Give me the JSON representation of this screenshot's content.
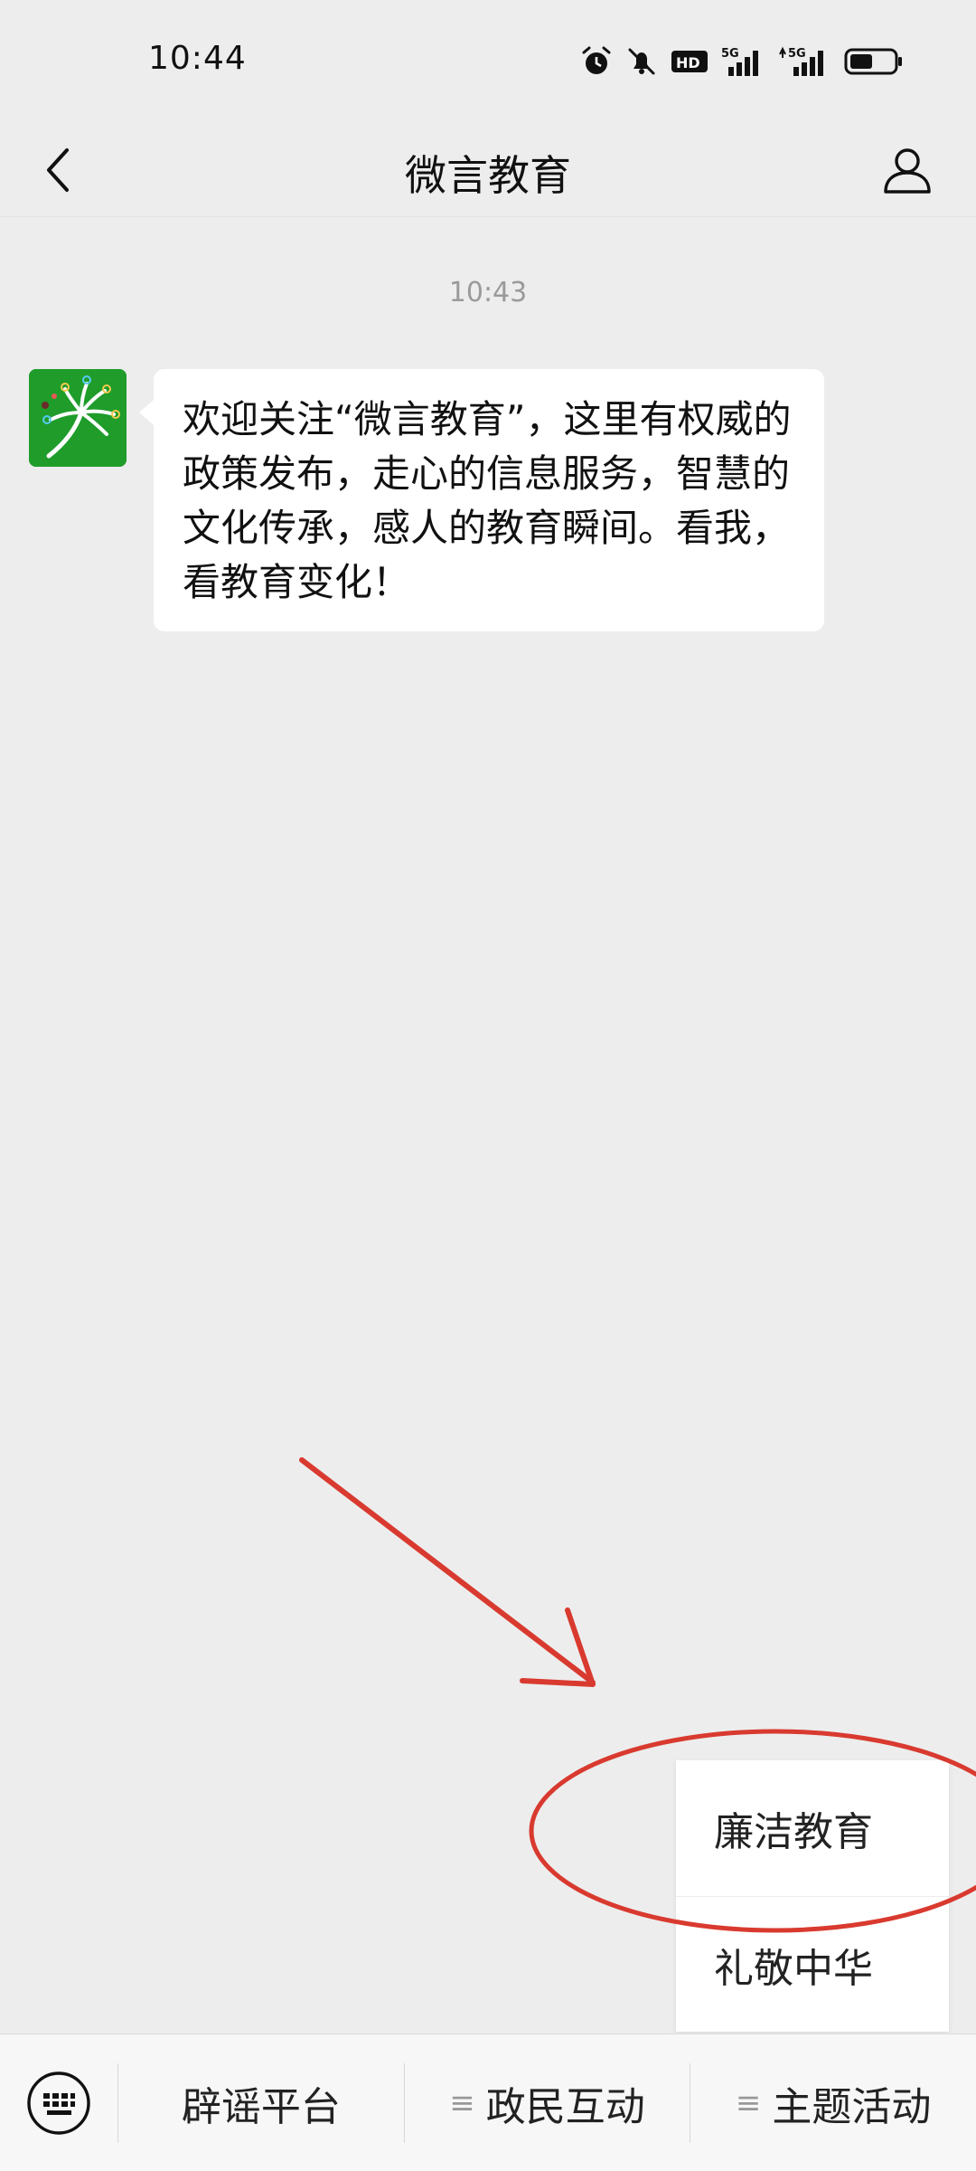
{
  "status_bar": {
    "time": "10:44",
    "icons": [
      "alarm-icon",
      "bell-muted-icon",
      "hd-icon",
      "signal-5g-icon",
      "signal-5g-icon",
      "battery-icon"
    ]
  },
  "nav": {
    "title": "微言教育"
  },
  "chat": {
    "timestamp": "10:43",
    "message": "欢迎关注“微言教育”，这里有权威的政策发布，走心的信息服务，智慧的文化传承，感人的教育瞬间。看我，看教育变化！"
  },
  "submenu": {
    "items": [
      {
        "label": "廉洁教育"
      },
      {
        "label": "礼敬中华"
      }
    ]
  },
  "bottom_menu": {
    "items": [
      {
        "label": "辟谣平台",
        "has_submenu": false
      },
      {
        "label": "政民互动",
        "has_submenu": true,
        "glyph": "≡"
      },
      {
        "label": "主题活动",
        "has_submenu": true,
        "glyph": "≡"
      }
    ]
  },
  "colors": {
    "background": "#ededed",
    "bubble": "#ffffff",
    "annotation": "#d93a2f",
    "avatar": "#1f9c2a"
  }
}
